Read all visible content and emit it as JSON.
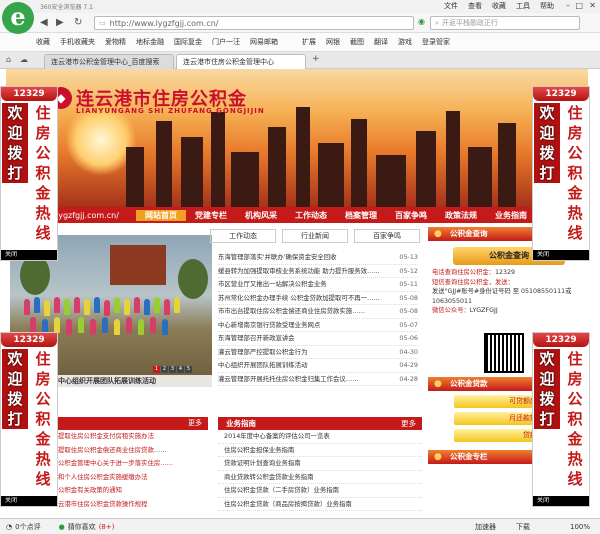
{
  "browser": {
    "app_name": "360安全浏览器 7.1",
    "menus": [
      "文件",
      "查看",
      "收藏",
      "工具",
      "帮助"
    ],
    "url": "http://www.lygzfgjj.com.cn/",
    "search_placeholder": "开返平栈歌政正行",
    "favorites": [
      "收藏",
      "手机收藏夹",
      "爱物精",
      "地标金融",
      "国际复金",
      "门户一汪",
      "网易邮箱"
    ],
    "toolbar_right": [
      "扩展",
      "网银",
      "截图",
      "翻译",
      "游戏",
      "登录管家"
    ],
    "tabs": [
      {
        "label": "连云港市公积金管理中心_百度搜索",
        "active": false
      },
      {
        "label": "连云港市住房公积金管理中心",
        "active": true
      }
    ],
    "status": {
      "left": "0个点评",
      "middle": "猜你喜欢",
      "count": "(8+)",
      "right": [
        "加速器",
        "下载",
        "100%"
      ]
    }
  },
  "site": {
    "title_cn": "连云港市住房公积金",
    "title_en": "LIANYUNGANG SHI ZHUFANG GONGJIJIN",
    "domain": "lygzfgjj.com.cn/",
    "nav": [
      "网站首页",
      "党建专栏",
      "机构风采",
      "工作动态",
      "档案管理",
      "百家争鸣",
      "政策法规",
      "业务指南"
    ],
    "news_tabs": [
      "工作动态",
      "行业新闻",
      "百家争鸣"
    ],
    "news": [
      {
        "title": "东海管理部落实'并联办'确保资金安全回收",
        "date": "05-13"
      },
      {
        "title": "缓县转为加强提取审核业务系统功能 助力提升服务效……",
        "date": "05-12"
      },
      {
        "title": "市区营业厅又推出一站解决公积金业务",
        "date": "05-11"
      },
      {
        "title": "苏州常化公积金办理手续 公积金贷款加提取可不再一……",
        "date": "05-08"
      },
      {
        "title": "市市出台提取住房公积金偿还商业住房贷款实施……",
        "date": "05-08"
      },
      {
        "title": "中心新增南京银行贷款受理业务网点",
        "date": "05-07"
      },
      {
        "title": "东海管理部召开新政宣讲会",
        "date": "05-06"
      },
      {
        "title": "灌云管理部严控提取公积金行为",
        "date": "04-30"
      },
      {
        "title": "中心组织开展团队拓展训练活动",
        "date": "04-29"
      },
      {
        "title": "灌云管理部开展托托住房公积金归集工作会议……",
        "date": "04-28"
      }
    ],
    "photo_caption": "中心组织开展团队拓展训练活动",
    "slide_numbers": [
      "1",
      "2",
      "3",
      "4",
      "5"
    ],
    "notice_more": "更多",
    "notices": [
      "提取住房公积金支付房租实施办法",
      "提取住房公积金偿还商业住房贷款……",
      "公积金管理中心关于进一步落实住房……",
      "和个人住房公积金实施缓缴办法",
      "公积金有关政策的通知",
      "云港市住房公积金贷款操作规程"
    ],
    "guide": {
      "title": "业务指南",
      "more": "更多",
      "items": [
        "2014年度中心备案的评估公司一览表",
        "住房公积金担保业务指南",
        "贷款证明计划查询业务指南",
        "商业贷款转公积金贷款业务指南",
        "住房公积金贷款（二手房贷款）业务指南",
        "住房公积金贷款（商品房按揭贷款）业务指南"
      ]
    },
    "right": {
      "query_head": "公积金查询",
      "query_button": "公积金查询",
      "phone_label": "电话查询住房公积金：",
      "phone": "12329",
      "sms_label": "短信查询住房公积金，发送：",
      "sms_body": "发送\"GJJ#账号#身份证号码 至 05108550111或1063055011",
      "wechat_label": "微信公众号：",
      "wechat": "LYGZFGJJ",
      "loan_head": "公积金贷款",
      "calc_buttons": [
        "可贷额度计算器",
        "月还款额计算器",
        "贷款利率表"
      ],
      "expert_head": "公积金专栏"
    }
  },
  "float_ad": {
    "hotline": "12329",
    "col_a": [
      "欢",
      "迎",
      "拨",
      "打"
    ],
    "col_b": [
      "住",
      "房",
      "公",
      "积",
      "金",
      "热",
      "线"
    ],
    "close": "关闭"
  }
}
